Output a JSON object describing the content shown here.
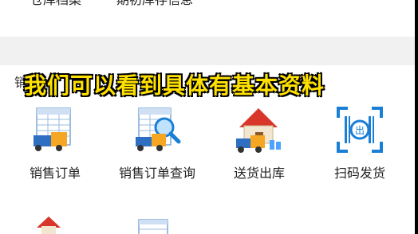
{
  "top_row": {
    "left": "仓库档案",
    "right": "期初库存信息"
  },
  "section": {
    "title": "销售"
  },
  "overlay_caption": "我们可以看到具体有基本资料",
  "items": [
    {
      "label": "销售订单",
      "icon": "sheet-truck-icon"
    },
    {
      "label": "销售订单查询",
      "icon": "sheet-truck-search-icon"
    },
    {
      "label": "送货出库",
      "icon": "house-truck-icon"
    },
    {
      "label": "扫码发货",
      "icon": "barcode-scan-icon"
    }
  ],
  "colors": {
    "accent_blue": "#1a7fd6",
    "house_red": "#d9362b",
    "caption_yellow": "#ffe100"
  }
}
